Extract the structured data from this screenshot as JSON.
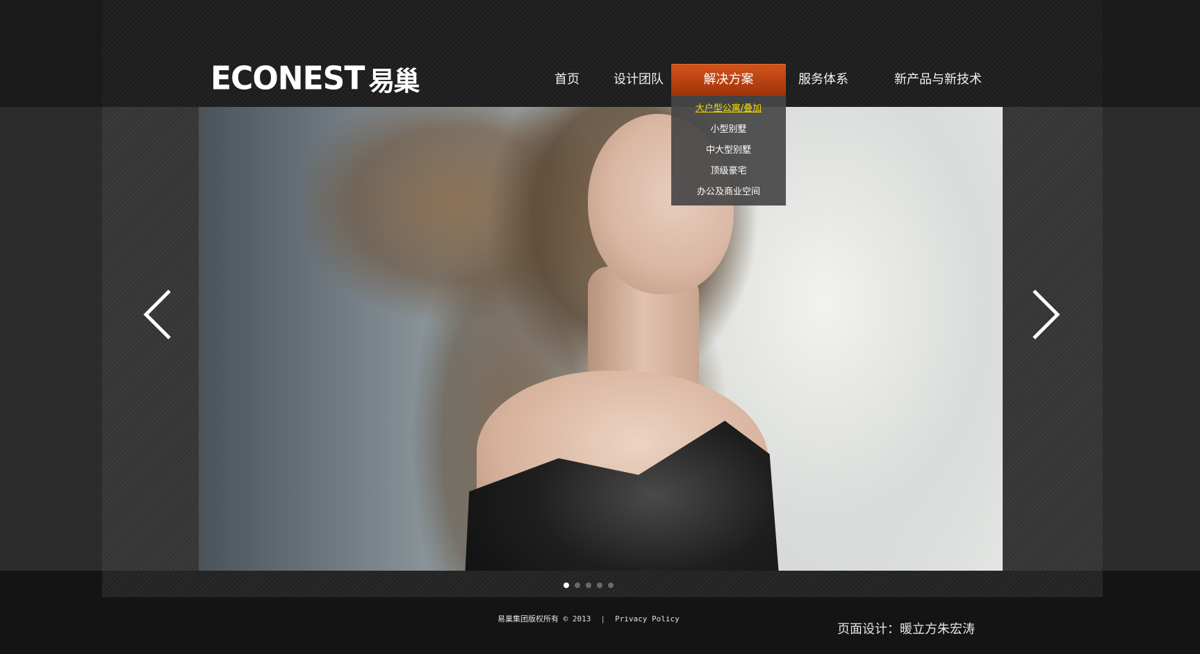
{
  "logo": {
    "word": "ECONEST",
    "cn": "易巢"
  },
  "nav": {
    "items": [
      {
        "label": "首页"
      },
      {
        "label": "设计团队"
      },
      {
        "label": "解决方案",
        "active": true
      },
      {
        "label": "服务体系"
      },
      {
        "label": "新产品与新技术"
      }
    ]
  },
  "dropdown": {
    "items": [
      {
        "label": "大户型公寓/叠加",
        "active": true
      },
      {
        "label": "小型别墅"
      },
      {
        "label": "中大型别墅"
      },
      {
        "label": "顶级豪宅"
      },
      {
        "label": "办公及商业空间"
      }
    ]
  },
  "slider": {
    "prev_icon": "chevron-left-icon",
    "next_icon": "chevron-right-icon",
    "dots_count": 5,
    "active_dot": 0
  },
  "footer": {
    "copyright": "易巢集团版权所有 © 2013",
    "separator": "|",
    "privacy": "Privacy Policy",
    "designer": "页面设计：暖立方朱宏涛"
  },
  "colors": {
    "nav_active_top": "#d4541a",
    "nav_active_bottom": "#9e3309",
    "dropdown_active_text": "#f5d800",
    "background": "#141414"
  }
}
